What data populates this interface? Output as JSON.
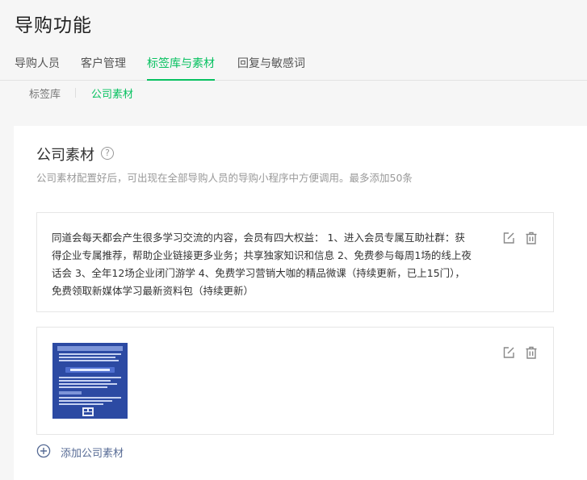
{
  "page": {
    "title": "导购功能"
  },
  "main_tabs": [
    {
      "label": "导购人员",
      "active": false
    },
    {
      "label": "客户管理",
      "active": false
    },
    {
      "label": "标签库与素材",
      "active": true
    },
    {
      "label": "回复与敏感词",
      "active": false
    }
  ],
  "sub_tabs": [
    {
      "label": "标签库",
      "active": false
    },
    {
      "label": "公司素材",
      "active": true
    }
  ],
  "card": {
    "title": "公司素材",
    "help_glyph": "?",
    "description": "公司素材配置好后，可出现在全部导购人员的导购小程序中方便调用。最多添加50条"
  },
  "materials": [
    {
      "type": "text",
      "lines": [
        "同道会每天都会产生很多学习交流的内容，会员有四大权益：  1、进入会员专属互助社群：获",
        "得企业专属推荐，帮助企业链接更多业务；共享独家知识和信息 2、免费参与每周1场的线上夜",
        "话会 3、全年12场企业闭门游学 4、免费学习营销大咖的精品微课（持续更新，已上15门），",
        "免费领取新媒体学习最新资料包（持续更新）"
      ]
    },
    {
      "type": "image"
    }
  ],
  "actions": {
    "add_label": "添加公司素材"
  },
  "colors": {
    "accent": "#07c160",
    "link": "#576b95",
    "image_bg": "#2c4aa3"
  },
  "icons": {
    "edit": "edit-icon",
    "delete": "trash-icon",
    "add": "plus-circle-icon",
    "help": "question-circle-icon"
  }
}
